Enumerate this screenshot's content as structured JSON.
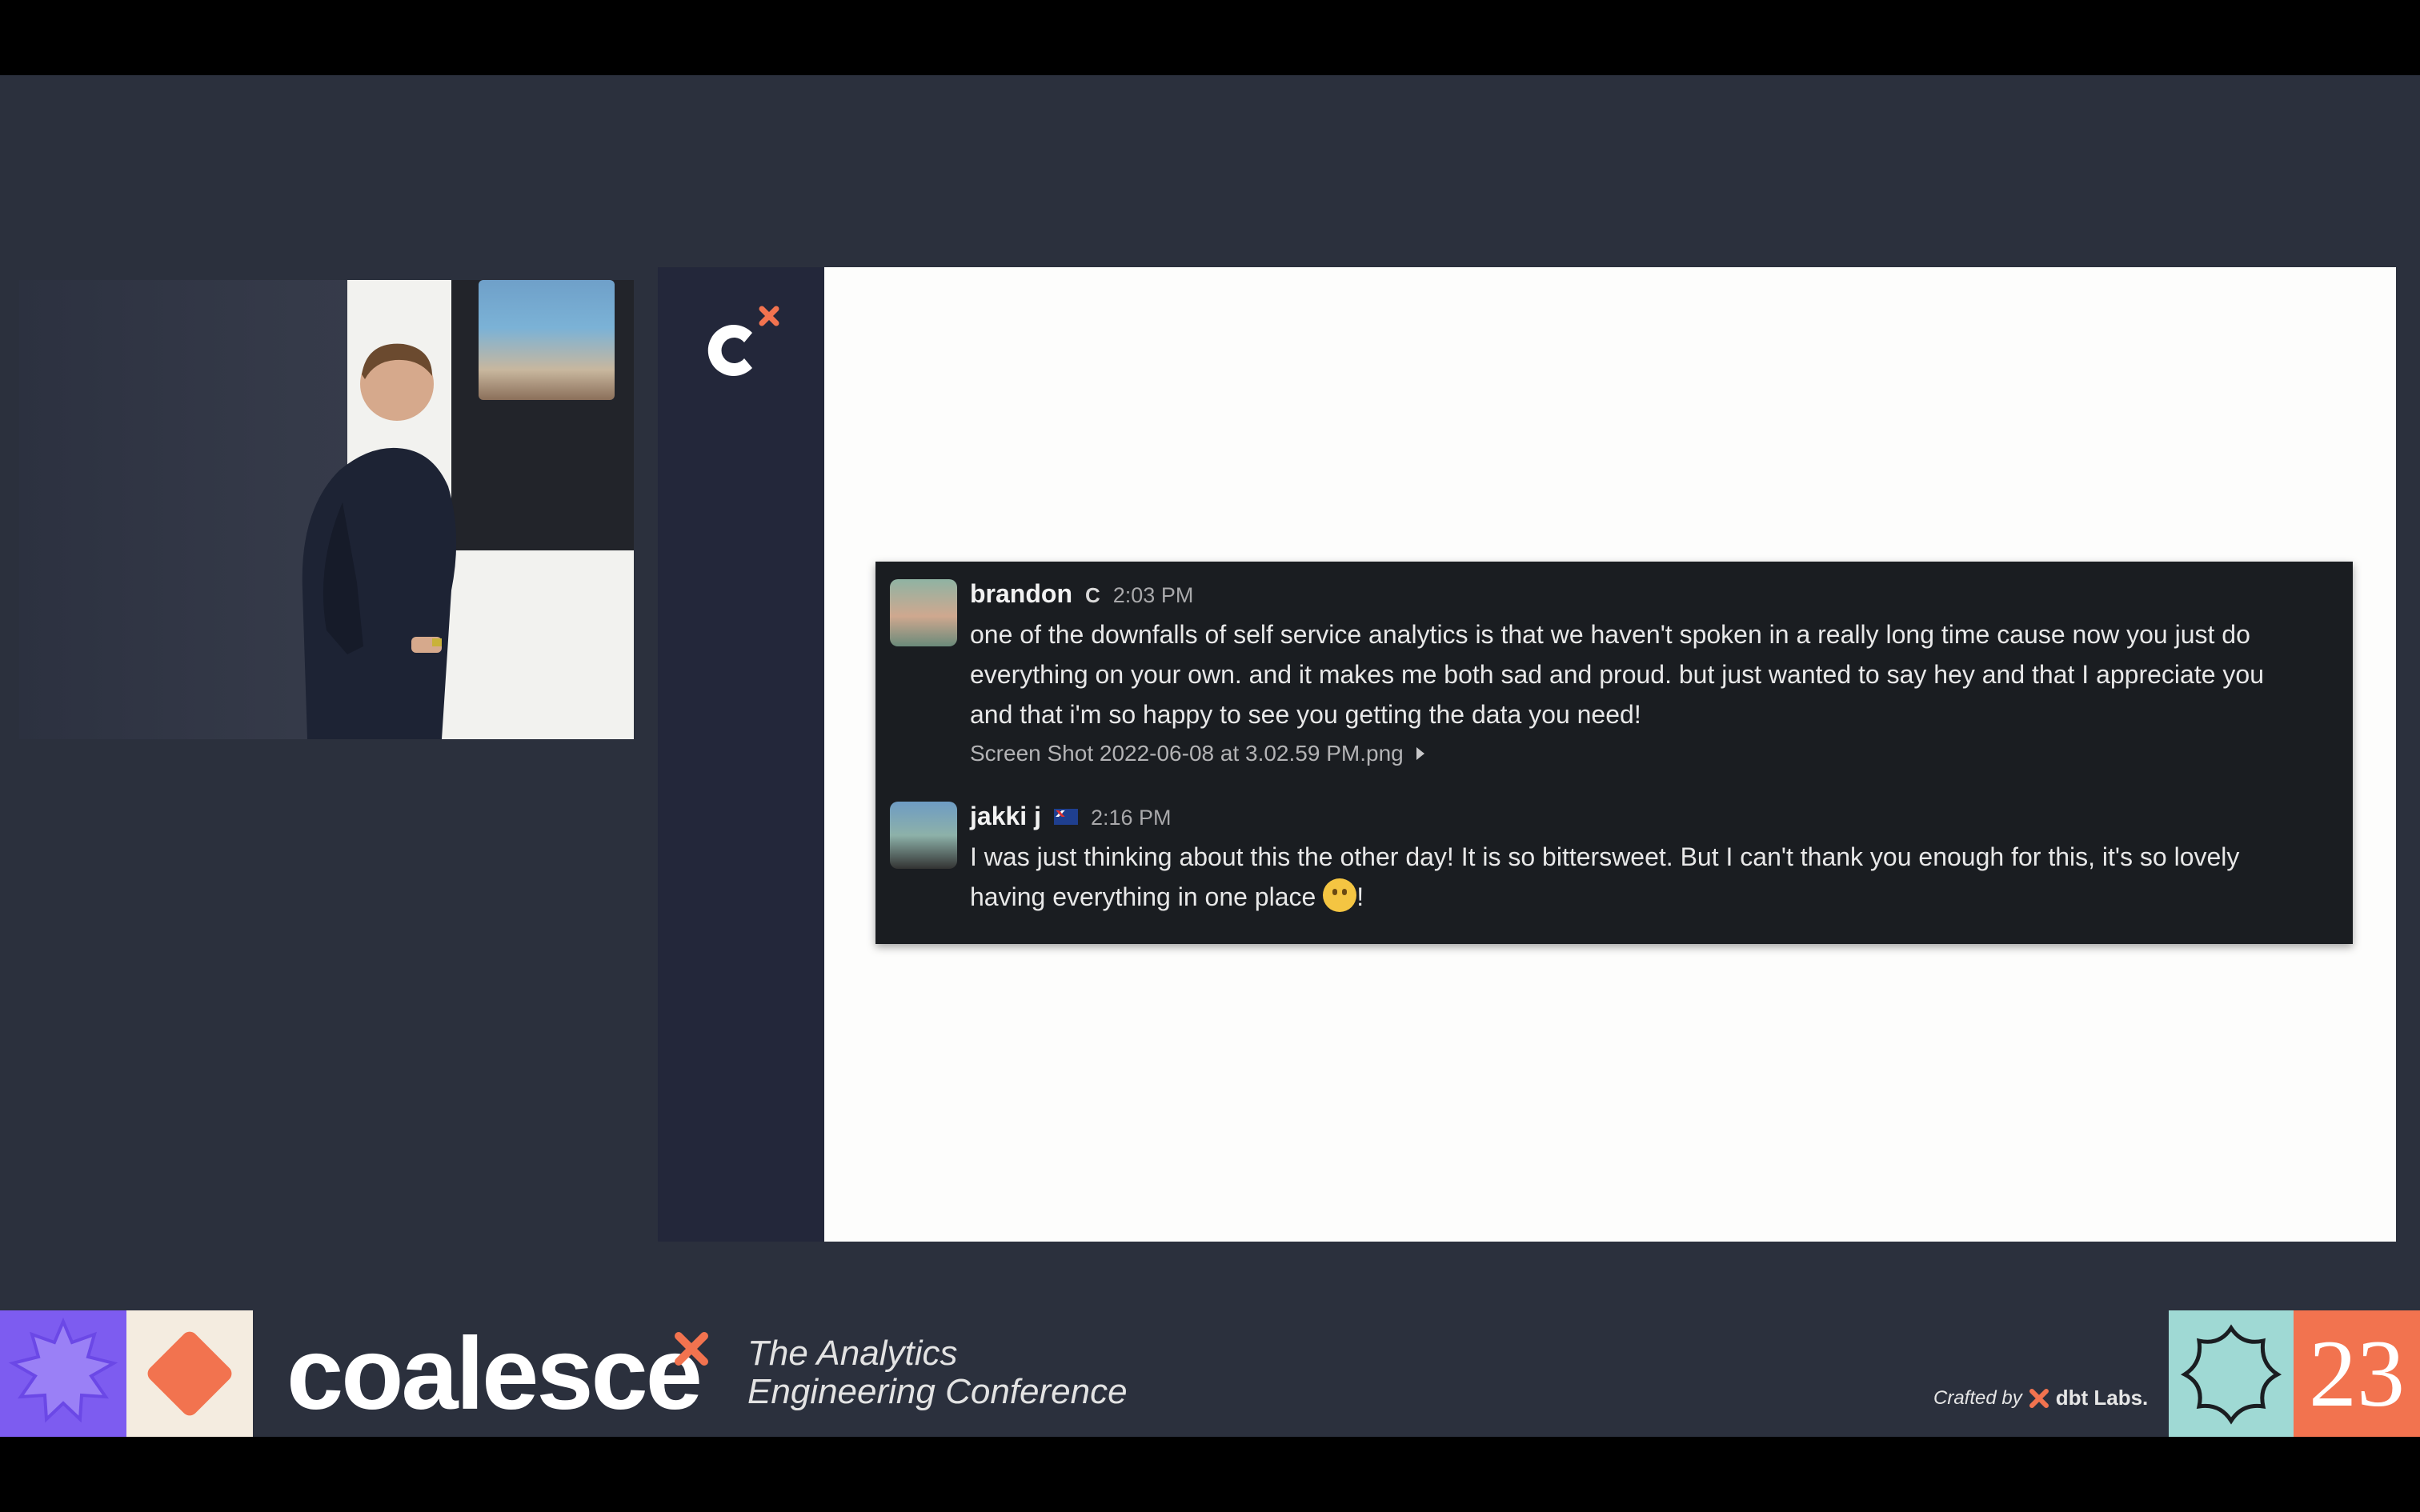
{
  "slide": {
    "logo_icon": "coalesce-c-icon",
    "messages": [
      {
        "author": "brandon",
        "badge": "C",
        "time": "2:03 PM",
        "lines": [
          "one of the downfalls of self service analytics is that we haven't spoken in a really long time cause now you just do",
          "everything on your own. and it makes me both sad and proud. but just wanted to say hey and that I appreciate you",
          "and that i'm so happy to see you getting the data you need!"
        ],
        "attachment": "Screen Shot 2022-06-08 at 3.02.59 PM.png"
      },
      {
        "author": "jakki j",
        "badge_icon": "australia-flag-icon",
        "time": "2:16 PM",
        "lines": [
          "I was just thinking about this the other day! It is so bittersweet. But I can't thank you enough for this, it's so lovely",
          "having everything in one place"
        ],
        "line_end": "!"
      }
    ]
  },
  "footer": {
    "brand": "coalesce",
    "tagline_line1": "The Analytics",
    "tagline_line2": "Engineering Conference",
    "crafted_by": "Crafted by",
    "crafted_org": "dbt Labs.",
    "year": "23"
  },
  "colors": {
    "stage": "#2b303d",
    "accent_orange": "#f2734f",
    "accent_purple": "#7d5cf0",
    "accent_teal": "#9fd9d4",
    "chat_bg": "#1a1d21"
  }
}
